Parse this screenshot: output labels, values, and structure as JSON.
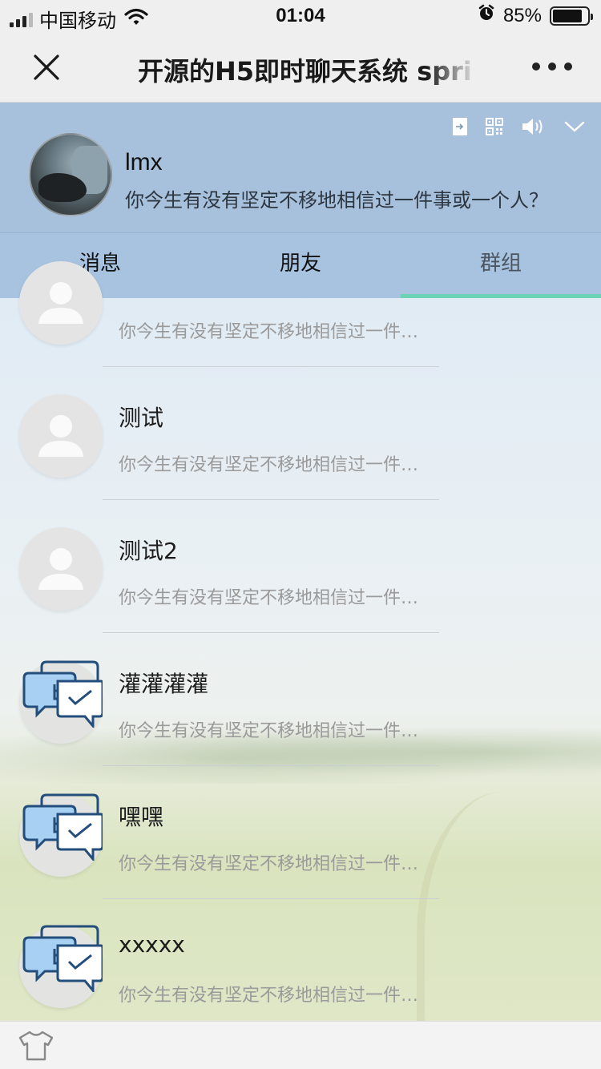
{
  "status_bar": {
    "carrier": "中国移动",
    "time": "01:04",
    "battery_percent": "85%",
    "battery_level": 0.85,
    "icons": [
      "signal-icon",
      "wifi-icon",
      "alarm-icon",
      "battery-icon"
    ]
  },
  "nav": {
    "title": "开源的H5即时聊天系统 spri",
    "close_icon": "close-icon",
    "more_icon": "more-icon"
  },
  "profile": {
    "name": "lmx",
    "signature": "你今生有没有坚定不移地相信过一件事或一个人？",
    "tool_icons": [
      "logout-icon",
      "qrcode-icon",
      "volume-icon",
      "chevron-down-icon"
    ]
  },
  "tabs": [
    {
      "label": "消息",
      "active": false
    },
    {
      "label": "朋友",
      "active": false
    },
    {
      "label": "群组",
      "active": true
    }
  ],
  "groups": [
    {
      "name": "",
      "preview": "你今生有没有坚定不移地相信过一件事或一个人？",
      "avatar": "person-placeholder-icon"
    },
    {
      "name": "测试",
      "preview": "你今生有没有坚定不移地相信过一件事或一个人？",
      "avatar": "person-placeholder-icon"
    },
    {
      "name": "测试2",
      "preview": "你今生有没有坚定不移地相信过一件事或一个人？",
      "avatar": "person-placeholder-icon"
    },
    {
      "name": "灌灌灌灌",
      "preview": "你今生有没有坚定不移地相信过一件事或一个人？",
      "avatar": "group-chat-icon"
    },
    {
      "name": "嘿嘿",
      "preview": "你今生有没有坚定不移地相信过一件事或一个人？",
      "avatar": "group-chat-icon"
    },
    {
      "name": "xxxxx",
      "preview": "你今生有没有坚定不移地相信过一件事或一个人？",
      "avatar": "group-chat-icon"
    }
  ],
  "colors": {
    "header_bg": "#a7c1dd",
    "tab_indicator": "#6cd3b4",
    "preview_text": "#9a9a9a"
  },
  "bottom_bar": {
    "icon": "shirt-icon"
  }
}
